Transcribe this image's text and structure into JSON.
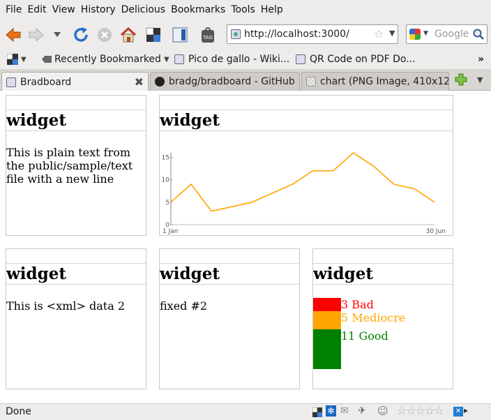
{
  "menu": [
    "File",
    "Edit",
    "View",
    "History",
    "Delicious",
    "Bookmarks",
    "Tools",
    "Help"
  ],
  "url": "http://localhost:3000/",
  "search_placeholder": "Google",
  "bookmarks": [
    "Recently Bookmarked",
    "Pico de gallo - Wiki...",
    "QR Code on PDF Do..."
  ],
  "bookmarks_overflow": "»",
  "tabs": [
    "Bradboard",
    "bradg/bradboard - GitHub",
    "chart (PNG Image, 410x12..."
  ],
  "widgets": {
    "w1": {
      "title": "widget",
      "body": "This is plain text from the public/sample/text file with a new line"
    },
    "w2": {
      "title": "widget"
    },
    "w3": {
      "title": "widget",
      "body": "This is <xml> data 2"
    },
    "w4": {
      "title": "widget",
      "body": "fixed #2"
    },
    "w5": {
      "title": "widget",
      "legend": [
        {
          "label": "3 Bad",
          "value": 3,
          "color": "#ff0000"
        },
        {
          "label": "5 Mediocre",
          "value": 5,
          "color": "#ffa500"
        },
        {
          "label": "11 Good",
          "value": 11,
          "color": "#008000"
        }
      ]
    }
  },
  "chart_data": {
    "type": "line",
    "x_start_label": "1 Jan",
    "x_end_label": "30 Jun",
    "yticks": [
      0,
      5,
      10,
      15
    ],
    "ylim": [
      0,
      16
    ],
    "values": [
      5,
      9,
      3,
      4,
      5,
      7,
      9,
      12,
      12,
      16,
      13,
      9,
      8,
      5
    ],
    "line_color": "#ffa500"
  },
  "status": "Done"
}
